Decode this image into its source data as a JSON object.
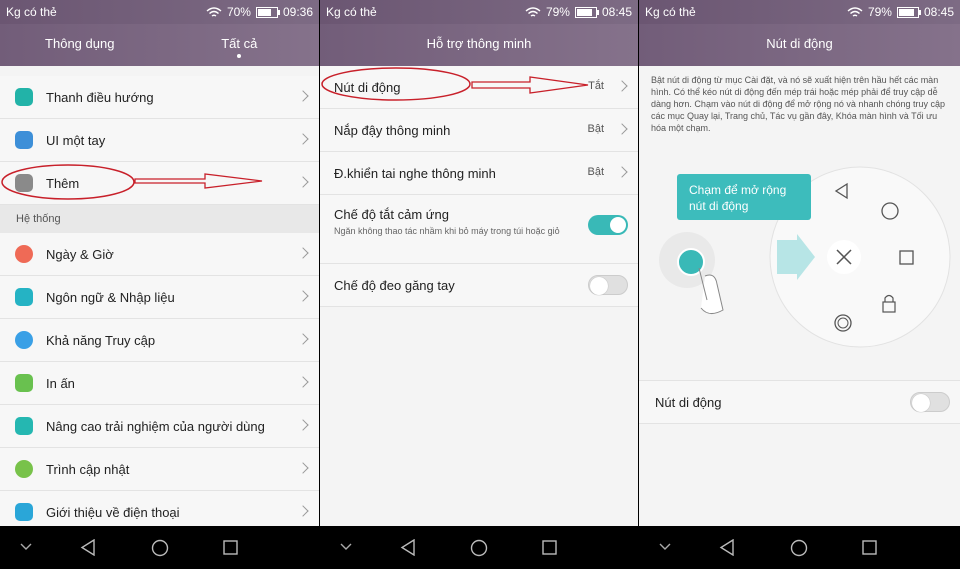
{
  "colors": {
    "header": "#725d79",
    "accent": "#39b9b7",
    "annotation": "#c8202a"
  },
  "p1": {
    "status": {
      "carrier": "Kg có thẻ",
      "battery": "70%",
      "time": "09:36",
      "battery_level": 0.7
    },
    "tabs": [
      "Thông dụng",
      "Tất cả"
    ],
    "rows1": [
      {
        "label": "Thanh điều hướng",
        "icon": "navbar-icon",
        "color": "#22b3a8"
      },
      {
        "label": "UI một tay",
        "icon": "one-hand-icon",
        "color": "#3d8fd8"
      },
      {
        "label": "Thêm",
        "icon": "more-icon",
        "color": "#8a8a8a"
      }
    ],
    "section": "Hệ thống",
    "rows2": [
      {
        "label": "Ngày & Giờ",
        "icon": "clock-icon",
        "color": "#ef6a56"
      },
      {
        "label": "Ngôn ngữ & Nhập liệu",
        "icon": "keyboard-icon",
        "color": "#25b3c4"
      },
      {
        "label": "Khả năng Truy cập",
        "icon": "hand-icon",
        "color": "#3aa0e6"
      },
      {
        "label": "In ấn",
        "icon": "printer-icon",
        "color": "#69c14f"
      },
      {
        "label": "Nâng cao trải nghiệm của người dùng",
        "icon": "user-icon",
        "color": "#25b7b1"
      },
      {
        "label": "Trình cập nhật",
        "icon": "update-icon",
        "color": "#78c24a"
      },
      {
        "label": "Giới thiệu về điện thoại",
        "icon": "phone-info-icon",
        "color": "#2aa6d8"
      }
    ]
  },
  "p2": {
    "status": {
      "carrier": "Kg có thẻ",
      "battery": "79%",
      "time": "08:45",
      "battery_level": 0.79
    },
    "title": "Hỗ trợ thông minh",
    "rows": [
      {
        "label": "Nút di động",
        "value": "Tắt"
      },
      {
        "label": "Nắp đậy thông minh",
        "value": "Bật"
      },
      {
        "label": "Đ.khiển tai nghe thông minh",
        "value": "Bật"
      }
    ],
    "toggle_rows": [
      {
        "label": "Chế độ tắt cảm ứng",
        "sub": "Ngăn không thao tác nhầm khi bỏ máy trong túi hoặc giỏ",
        "on": true
      },
      {
        "label": "Chế độ đeo găng tay",
        "sub": "",
        "on": false
      }
    ]
  },
  "p3": {
    "status": {
      "carrier": "Kg có thẻ",
      "battery": "79%",
      "time": "08:45",
      "battery_level": 0.79
    },
    "title": "Nút di động",
    "description": "Bật nút di động từ mục Cài đặt, và nó sẽ xuất hiện trên hầu hết các màn hình. Có thể kéo nút di động đến mép trái hoặc mép phải để truy cập dễ dàng hơn. Chạm vào nút di động để mở rộng nó và nhanh chóng truy cập các mục Quay lại, Trang chủ, Tác vụ gần đây, Khóa màn hình và Tối ưu hóa một chạm.",
    "tooltip": "Chạm để mở rộng nút di động",
    "toggle_label": "Nút di động",
    "toggle_on": false
  }
}
